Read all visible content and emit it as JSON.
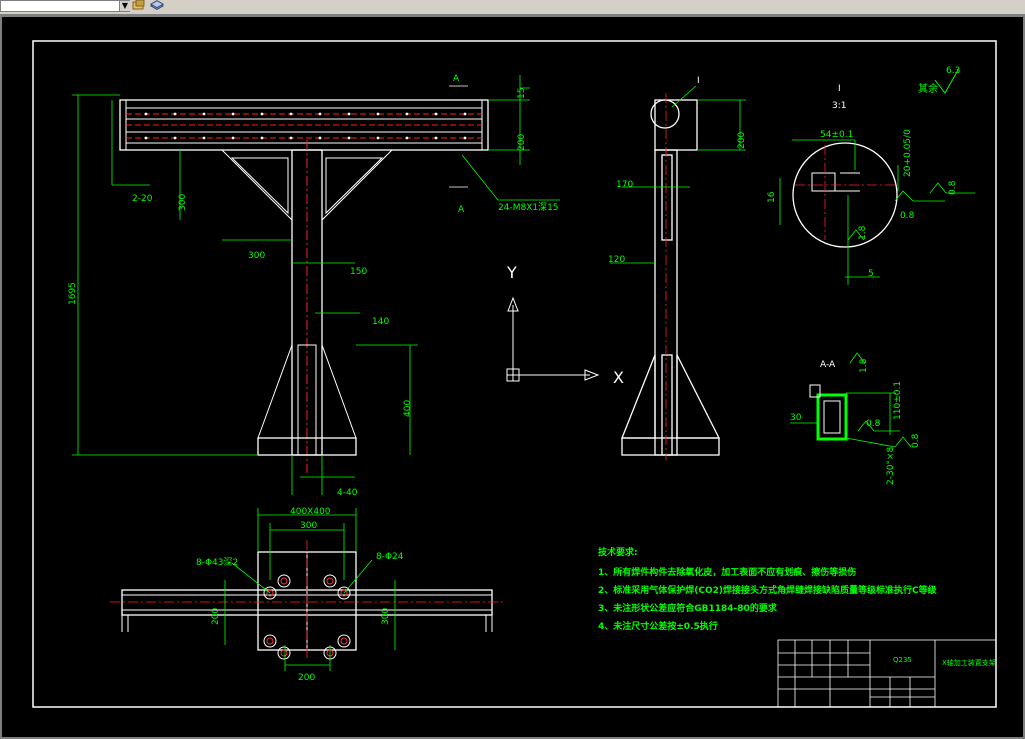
{
  "colors": {
    "background": "#000000",
    "frame": "#ffffff",
    "dim": "#00ff00",
    "center": "#ff2020",
    "geometry": "#ffffff",
    "hole": "#ff3030"
  },
  "toolbar": {
    "layer_icon": "layer-state-icon",
    "layer_tools_icon": "layer-tools-icon"
  },
  "front_view": {
    "section_marks": [
      "A",
      "A"
    ],
    "dims": [
      "15",
      "200",
      "300",
      "2-20",
      "300",
      "150",
      "140",
      "400",
      "4-40",
      "1695"
    ],
    "callout": "24-M8X1深15"
  },
  "side_view": {
    "detail_mark": "I",
    "dims": [
      "200",
      "170",
      "120"
    ]
  },
  "detail_view": {
    "title": "I",
    "scale": "3:1",
    "dims": [
      "54±0.1",
      "20+0.05/0",
      "16",
      "5"
    ],
    "roughness": [
      "0.8",
      "0.8",
      "1.8"
    ]
  },
  "surface_finish_rest": {
    "label": "其余",
    "value": "6.3"
  },
  "section_view": {
    "title": "A-A",
    "dims": [
      "30",
      "110±0.1",
      "2-30°×8"
    ],
    "roughness": [
      "1.8",
      "0.8",
      "0.8"
    ]
  },
  "ucs": {
    "y": "Y",
    "x": "X"
  },
  "plan_view": {
    "dims": [
      "400X400",
      "300",
      "200",
      "300",
      "200"
    ],
    "callouts": [
      "8-Φ43深2",
      "8-Φ24"
    ]
  },
  "tech_requirements": {
    "title": "技术要求:",
    "items": [
      "1、所有焊件构件去除氧化皮，加工表面不应有划痕、擦伤等损伤",
      "2、标准采用气体保护焊(CO2)焊接接头方式角焊缝焊接缺陷质量等级标准执行C等级",
      "3、未注形状公差应符合GB1184-80的要求",
      "4、未注尺寸公差按±0.5执行"
    ]
  },
  "title_block": {
    "material": "Q235",
    "drawing_name": "X轴加工装置支架"
  }
}
